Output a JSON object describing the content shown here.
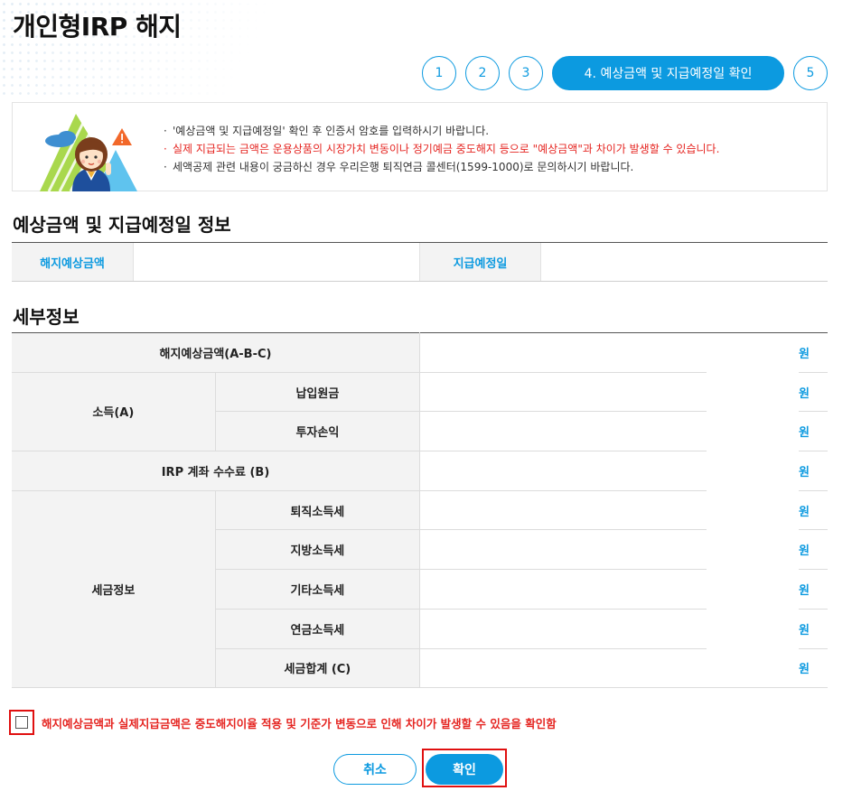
{
  "page": {
    "title": "개인형IRP 해지"
  },
  "steps": [
    {
      "label": "1",
      "active": false
    },
    {
      "label": "2",
      "active": false
    },
    {
      "label": "3",
      "active": false
    },
    {
      "label": "4. 예상금액 및 지급예정일 확인",
      "active": true
    },
    {
      "label": "5",
      "active": false
    }
  ],
  "notice": {
    "items": [
      "'예상금액 및 지급예정일' 확인 후 인증서 암호를 입력하시기 바랍니다.",
      "실제 지급되는 금액은 운용상품의 시장가치 변동이나 정기예금 중도해지 등으로 \"예상금액\"과 차이가 발생할 수 있습니다.",
      "세액공제 관련 내용이 궁금하신 경우 우리은행 퇴직연금 콜센터(1599-1000)로 문의하시기 바랍니다."
    ]
  },
  "summary": {
    "title": "예상금액 및 지급예정일 정보",
    "estimated_label": "해지예상금액",
    "estimated_value": "",
    "payment_date_label": "지급예정일",
    "payment_date_value": ""
  },
  "detail": {
    "title": "세부정보",
    "unit": "원",
    "rows": {
      "estimated_total": {
        "label": "해지예상금액(A-B-C)",
        "value": ""
      },
      "income_group": "소득(A)",
      "principal": {
        "label": "납입원금",
        "value": ""
      },
      "investment_pl": {
        "label": "투자손익",
        "value": ""
      },
      "irp_fee": {
        "label": "IRP 계좌 수수료 (B)",
        "value": ""
      },
      "tax_group": "세금정보",
      "retirement_tax": {
        "label": "퇴직소득세",
        "value": ""
      },
      "local_tax": {
        "label": "지방소득세",
        "value": ""
      },
      "other_tax": {
        "label": "기타소득세",
        "value": ""
      },
      "pension_tax": {
        "label": "연금소득세",
        "value": ""
      },
      "tax_total": {
        "label": "세금합계 (C)",
        "value": ""
      }
    }
  },
  "agreement": {
    "checked": false,
    "label": "해지예상금액과 실제지급금액은 중도해지이율 적용 및 기준가 변동으로 인해 차이가 발생할 수 있음을 확인함"
  },
  "buttons": {
    "cancel": "취소",
    "confirm": "확인"
  },
  "colors": {
    "accent": "#0c9ae0",
    "warning": "#e52521",
    "highlight_frame": "#e01010"
  }
}
